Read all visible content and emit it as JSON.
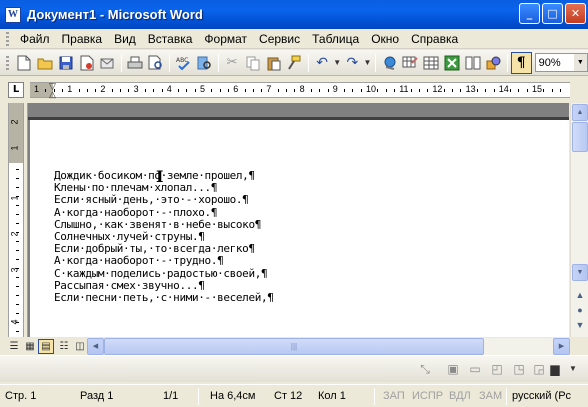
{
  "window": {
    "title": "Документ1 - Microsoft Word",
    "app_icon": "W",
    "buttons": {
      "minimize": "_",
      "maximize": "□",
      "close": "✕"
    }
  },
  "menu": [
    {
      "label": "Файл",
      "name": "menu-file"
    },
    {
      "label": "Правка",
      "name": "menu-edit"
    },
    {
      "label": "Вид",
      "name": "menu-view"
    },
    {
      "label": "Вставка",
      "name": "menu-insert"
    },
    {
      "label": "Формат",
      "name": "menu-format"
    },
    {
      "label": "Сервис",
      "name": "menu-tools"
    },
    {
      "label": "Таблица",
      "name": "menu-table"
    },
    {
      "label": "Окно",
      "name": "menu-window"
    },
    {
      "label": "Справка",
      "name": "menu-help"
    }
  ],
  "toolbar": {
    "zoom": "90%",
    "show_formatting": "¶"
  },
  "ruler": {
    "tab_selector": "L",
    "h_numbers": [
      "1",
      "1",
      "2",
      "3",
      "4",
      "5",
      "6",
      "7",
      "8",
      "9",
      "10",
      "11",
      "12",
      "13",
      "14",
      "15"
    ],
    "v_numbers": [
      "2",
      "1",
      "1",
      "2",
      "3",
      "4"
    ]
  },
  "document": {
    "lines": [
      "Дождик·босиком·по·земле·прошел,¶",
      "Клены·по·плечам·хлопал...¶",
      "Если·ясный·день,·это·-·хорошо.¶",
      "А·когда·наоборот·-·плохо.¶",
      "Слышно,·как·звенят·в·небе·высоко¶",
      "Солнечных·лучей·струны.¶",
      "Если·добрый·ты,·то·всегда·легко¶",
      "А·когда·наоборот·-·трудно.¶",
      "С·каждым·поделись·радостью·своей,¶",
      "Рассыпая·смех·звучно...¶",
      "Если·песни·петь,·с·ними·-·веселей,¶"
    ]
  },
  "statusbar": {
    "page": "Стр. 1",
    "section": "Разд  1",
    "pages": "1/1",
    "position": "На 6,4см",
    "line": "Ст  12",
    "column": "Кол  1",
    "rec": "ЗАП",
    "trk": "ИСПР",
    "ext": "ВДЛ",
    "ovr": "ЗАМ",
    "language": "русский (Рс"
  }
}
